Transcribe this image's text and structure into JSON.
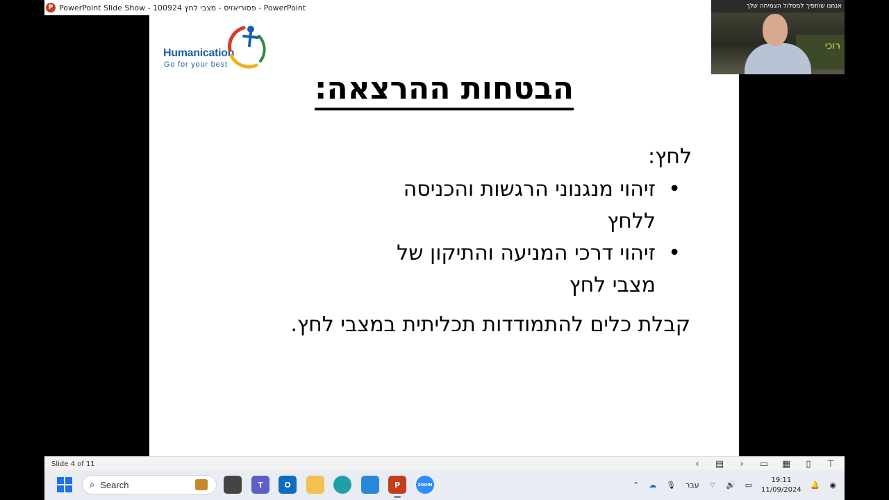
{
  "window": {
    "title": "PowerPoint Slide Show  -  100924 פסוריאזיס - מצבי לחץ - PowerPoint"
  },
  "slide": {
    "logo": {
      "word": "Humanication",
      "tagline": "Go for your best"
    },
    "title": "הבטחות ההרצאה:",
    "heading": "לחץ:",
    "bullets": [
      {
        "text": "זיהוי מנגנוני הרגשות והכניסה ללחץ"
      },
      {
        "text": "זיהוי דרכי המניעה והתיקון של מצבי לחץ"
      }
    ],
    "closing": "קבלת כלים להתמודדות תכליתית במצבי לחץ."
  },
  "webcam": {
    "banner": "אנחנו שותפיך למסלול הצמיחה שלך",
    "board_text": "רוכי"
  },
  "statusbar": {
    "slide_counter": "Slide 4 of 11"
  },
  "taskbar": {
    "search_label": "Search",
    "language": "עבר",
    "time": "19:11",
    "date": "11/09/2024",
    "accent": "#1a73e8"
  }
}
